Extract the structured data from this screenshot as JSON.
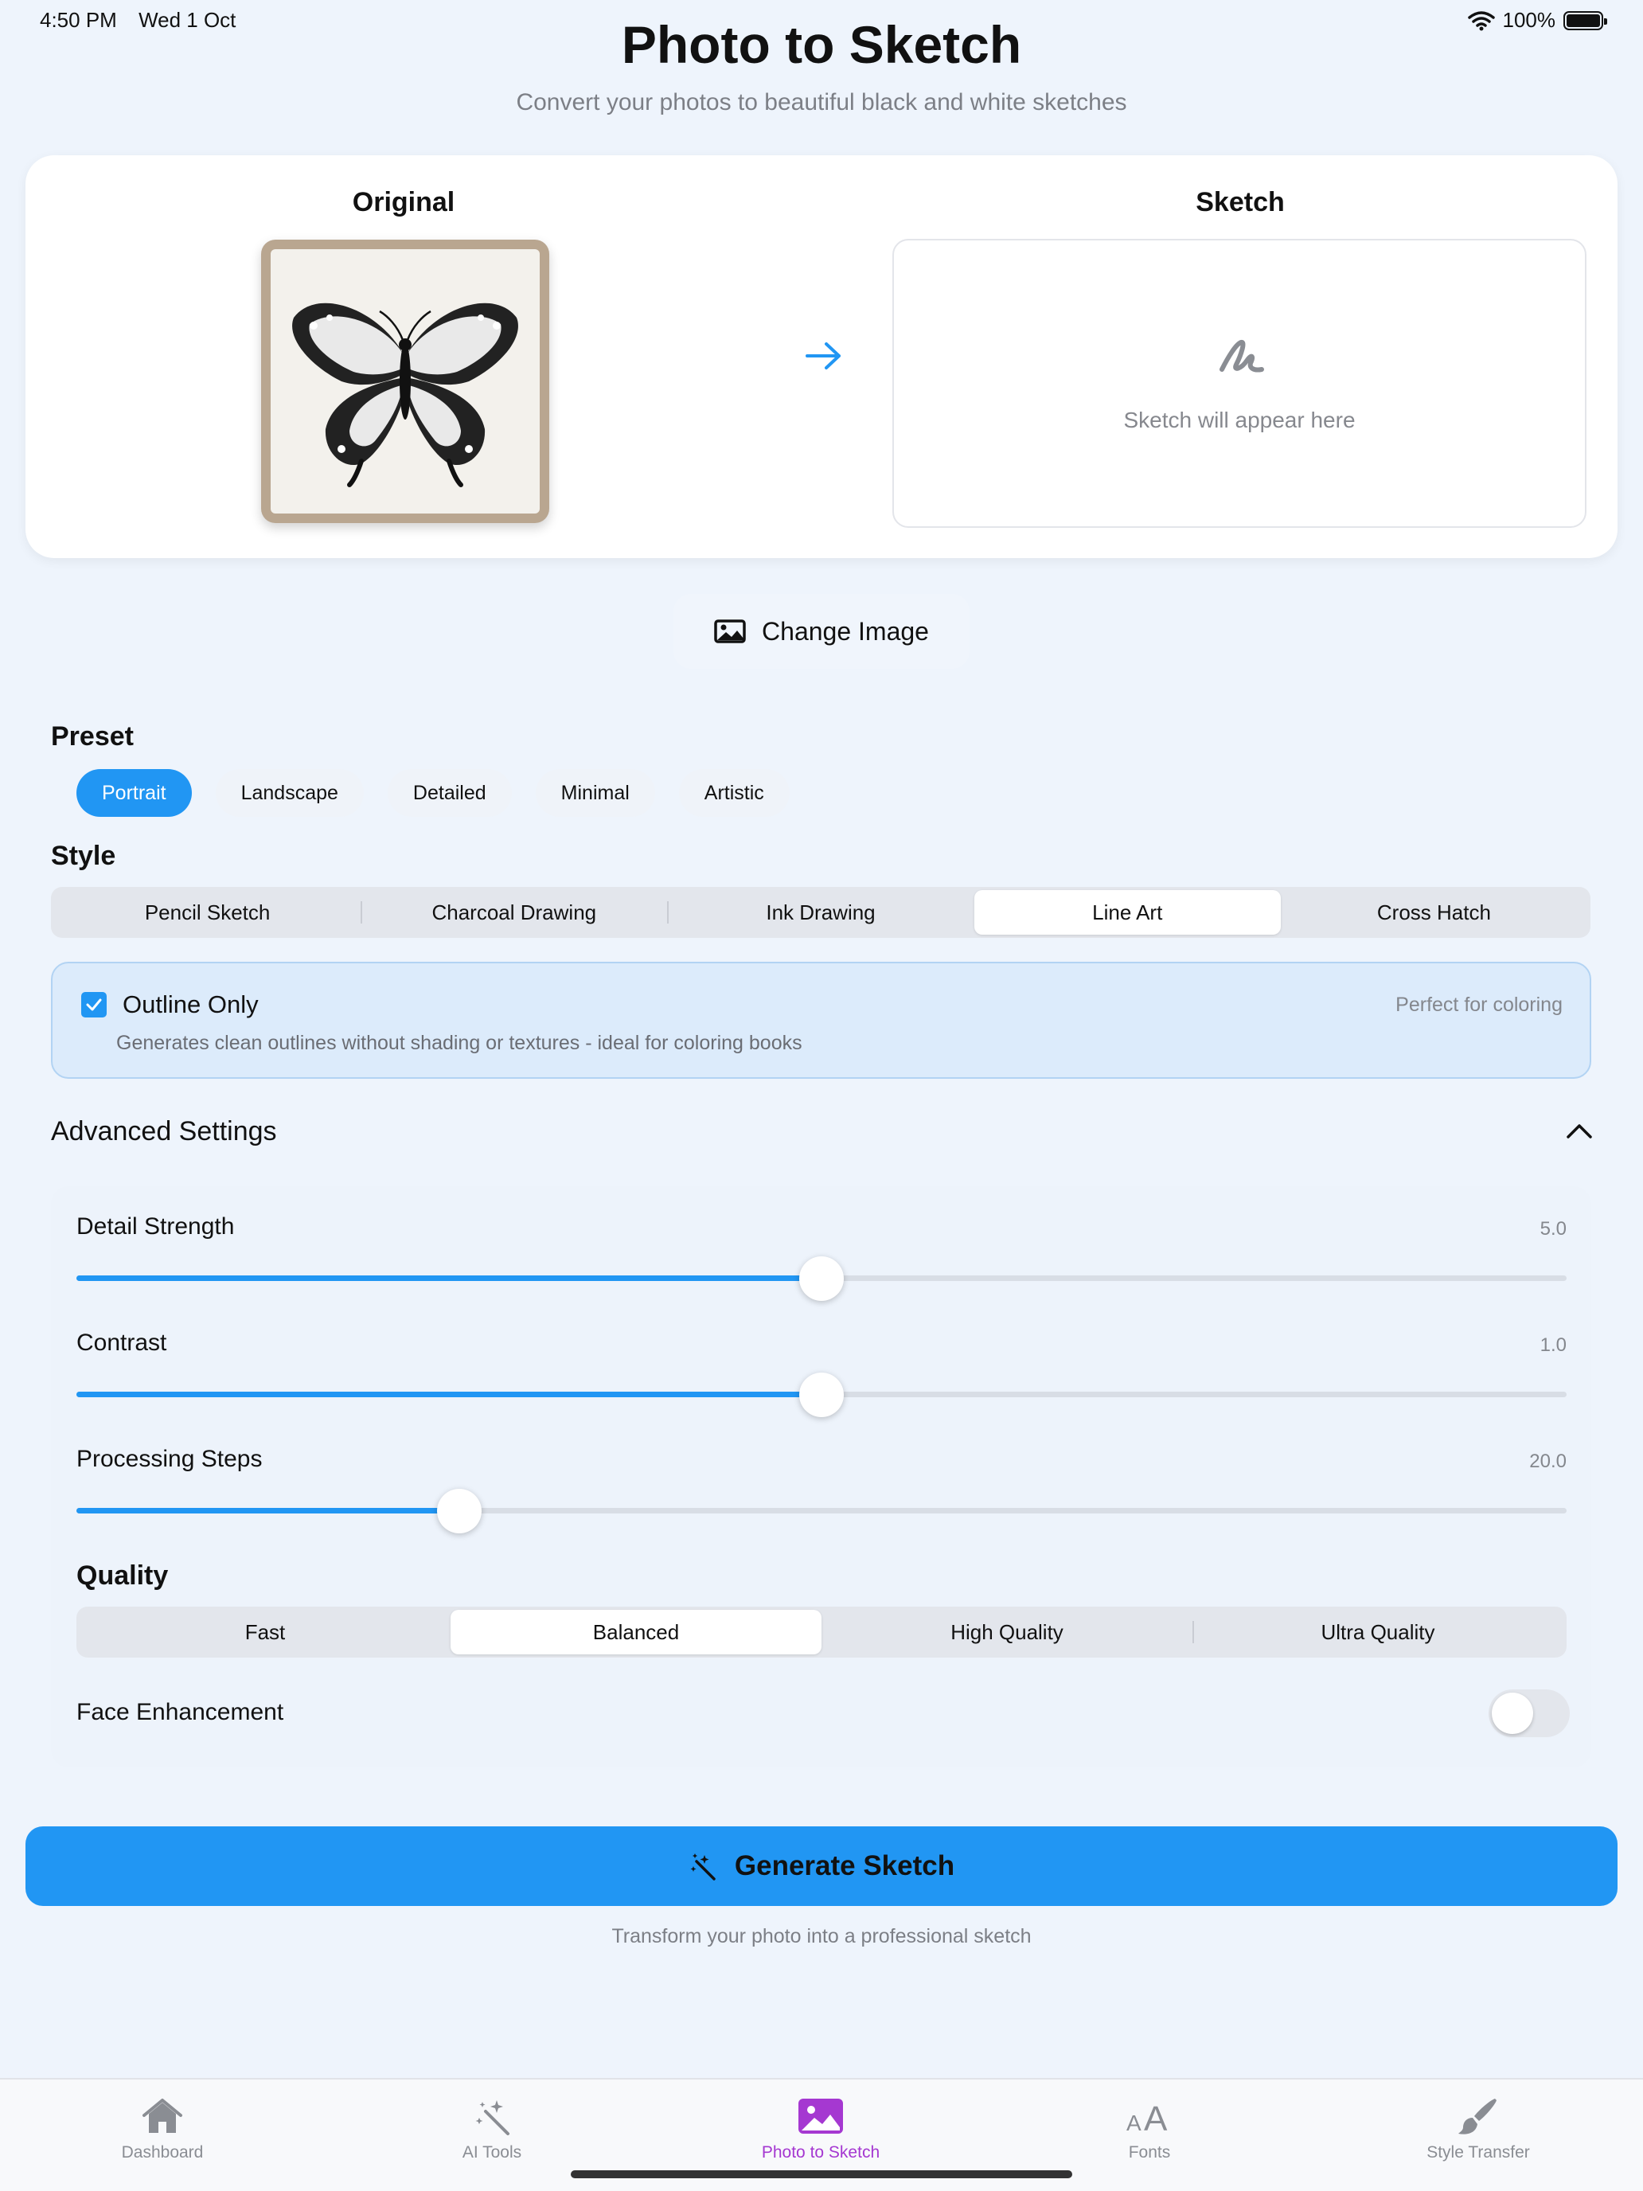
{
  "status": {
    "time": "4:50 PM",
    "date": "Wed 1 Oct",
    "battery": "100%"
  },
  "header": {
    "title": "Photo to Sketch",
    "subtitle": "Convert your photos to beautiful black and white sketches"
  },
  "compare": {
    "original_label": "Original",
    "sketch_label": "Sketch",
    "sketch_placeholder": "Sketch will appear here"
  },
  "change_image_label": "Change Image",
  "preset": {
    "label": "Preset",
    "options": [
      "Portrait",
      "Landscape",
      "Detailed",
      "Minimal",
      "Artistic"
    ],
    "selected": "Portrait"
  },
  "style": {
    "label": "Style",
    "options": [
      "Pencil Sketch",
      "Charcoal Drawing",
      "Ink Drawing",
      "Line Art",
      "Cross Hatch"
    ],
    "selected": "Line Art"
  },
  "outline": {
    "title": "Outline Only",
    "tag": "Perfect for coloring",
    "description": "Generates clean outlines without shading or textures - ideal for coloring books",
    "checked": true
  },
  "advanced": {
    "title": "Advanced Settings",
    "expanded": true,
    "sliders": [
      {
        "label": "Detail Strength",
        "value": "5.0",
        "fraction": 0.5
      },
      {
        "label": "Contrast",
        "value": "1.0",
        "fraction": 0.5
      },
      {
        "label": "Processing Steps",
        "value": "20.0",
        "fraction": 0.257
      }
    ],
    "quality": {
      "label": "Quality",
      "options": [
        "Fast",
        "Balanced",
        "High Quality",
        "Ultra Quality"
      ],
      "selected": "Balanced"
    },
    "face_enhancement": {
      "label": "Face Enhancement",
      "on": false
    }
  },
  "generate": {
    "label": "Generate Sketch",
    "caption": "Transform your photo into a professional sketch"
  },
  "tabs": [
    {
      "label": "Dashboard",
      "icon": "house-icon"
    },
    {
      "label": "AI Tools",
      "icon": "magic-wand-icon"
    },
    {
      "label": "Photo to Sketch",
      "icon": "photo-icon",
      "active": true
    },
    {
      "label": "Fonts",
      "icon": "text-size-icon"
    },
    {
      "label": "Style Transfer",
      "icon": "paintbrush-icon"
    }
  ],
  "colors": {
    "accent": "#2196f3",
    "active_tab": "#a538d1",
    "background": "#eef4fc"
  }
}
